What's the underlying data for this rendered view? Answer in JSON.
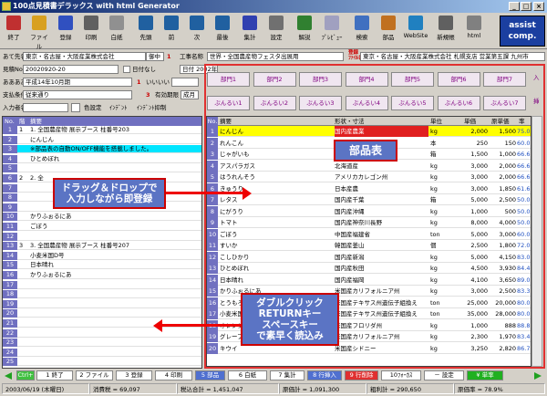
{
  "window": {
    "title": "100点見積書デラックス with html Generator",
    "btn_min": "_",
    "btn_max": "□",
    "btn_close": "×"
  },
  "toolbar": [
    {
      "id": "exit",
      "label": "終了",
      "icon": "door-icon",
      "color": "#c03030"
    },
    {
      "id": "file",
      "label": "ファイル",
      "icon": "folder-icon",
      "color": "#d8a020"
    },
    {
      "id": "register",
      "label": "登録",
      "icon": "disk-icon",
      "color": "#3050c0"
    },
    {
      "id": "print",
      "label": "印刷",
      "icon": "printer-icon",
      "color": "#606060"
    },
    {
      "id": "blank",
      "label": "白紙",
      "icon": "blank-page-icon",
      "color": "#909090"
    },
    {
      "id": "first",
      "label": "先頭",
      "icon": "first-icon",
      "color": "#2060a0"
    },
    {
      "id": "prev",
      "label": "前",
      "icon": "prev-icon",
      "color": "#2060a0"
    },
    {
      "id": "next",
      "label": "次",
      "icon": "next-icon",
      "color": "#2060a0"
    },
    {
      "id": "last",
      "label": "最後",
      "icon": "last-icon",
      "color": "#2060a0"
    },
    {
      "id": "total",
      "label": "集計",
      "icon": "sigma-icon",
      "color": "#3040b0"
    },
    {
      "id": "settings",
      "label": "設定",
      "icon": "gear-icon",
      "color": "#707070"
    },
    {
      "id": "help",
      "label": "解説",
      "icon": "book-icon",
      "color": "#308030"
    },
    {
      "id": "preview",
      "label": "ﾌﾟﾚﾋﾞｭｰ",
      "icon": "preview-icon",
      "color": "#a0a0c0"
    },
    {
      "id": "search",
      "label": "検索",
      "icon": "search-icon",
      "color": "#4070c0"
    },
    {
      "id": "parts",
      "label": "部品",
      "icon": "parts-icon",
      "color": "#c07020"
    },
    {
      "id": "website",
      "label": "WebSite",
      "icon": "globe-icon",
      "color": "#2080c0"
    },
    {
      "id": "newdoc",
      "label": "新規帳",
      "icon": "newdoc-icon",
      "color": "#606060"
    },
    {
      "id": "html",
      "label": "html",
      "icon": "html-icon",
      "color": "#808080"
    }
  ],
  "logo": {
    "line1": "assist",
    "line2": "comp."
  },
  "form": {
    "atesaki_label": "あて先名",
    "atesaki_value": "東京・名古屋・大阪産業株式会社",
    "atesaki_unit": "御中",
    "atesaki_flag": "1",
    "koji_label": "工事名称",
    "koji_value": "世界・全国農産物フェスタ出展用",
    "toroku_label": "登録\nﾌｧｲﾙ名",
    "toroku_value": "東京・名古屋・大阪産業株式会社 札幌支店 営業第五課 九州市",
    "mitsumori_label": "見積No.",
    "mitsumori_value": "20020920-20",
    "nichiji_label": "日付なし",
    "date_value": "日付 2002年",
    "doc_label": "ああああ",
    "doc_value": "平成14年10月期",
    "kigen_label": "いいいい",
    "kigen_flag": "1",
    "shiharai_label": "支払条件",
    "shiharai_value": "従来通り",
    "shiharai_flag": "3",
    "yukokigen_label": "有効期限",
    "yukokigen_value": "成月",
    "nyuryoku_label": "入力者名",
    "iro_label": "色設定",
    "indent_label": "ｲﾝﾃﾞﾝﾄ",
    "indent_label2": "ｲﾝﾃﾞﾝﾄ抑制"
  },
  "tabs_row1": [
    "部門1",
    "部門2",
    "部門3",
    "部門4",
    "部門5",
    "部門6",
    "部門7"
  ],
  "tabs_row2": [
    "ぶんるい1",
    "ぶんるい2",
    "ぶんるい3",
    "ぶんるい4",
    "ぶんるい5",
    "ぶんるい6",
    "ぶんるい7"
  ],
  "tab_side1": "入",
  "tab_side2": "挿",
  "left_grid": {
    "headers": [
      "No.",
      "階",
      "摘要"
    ],
    "rows": [
      {
        "no": "1",
        "lv": "1",
        "text": "1. 全国農産物 展示ブース 柱番号203",
        "hl": false
      },
      {
        "no": "2",
        "lv": "",
        "text": "にんじん",
        "hl": false
      },
      {
        "no": "3",
        "lv": "",
        "text": "※部品表の自動ON/OFF機能を搭載しました。",
        "hl": true
      },
      {
        "no": "4",
        "lv": "",
        "text": "ひとめぼれ",
        "hl": false
      },
      {
        "no": "5",
        "lv": "",
        "text": "",
        "hl": false
      },
      {
        "no": "6",
        "lv": "2",
        "text": "2. 全",
        "hl": false
      },
      {
        "no": "7",
        "lv": "",
        "text": "",
        "hl": false
      },
      {
        "no": "8",
        "lv": "",
        "text": "",
        "hl": false
      },
      {
        "no": "9",
        "lv": "",
        "text": "",
        "hl": false
      },
      {
        "no": "10",
        "lv": "",
        "text": "かりふぉるにあ",
        "hl": false
      },
      {
        "no": "11",
        "lv": "",
        "text": "ごぼう",
        "hl": false
      },
      {
        "no": "12",
        "lv": "",
        "text": "",
        "hl": false
      },
      {
        "no": "13",
        "lv": "3",
        "text": "3. 全国農産物 展示ブース 柱番号207",
        "hl": false
      },
      {
        "no": "14",
        "lv": "",
        "text": "小麦米国D号",
        "hl": false
      },
      {
        "no": "15",
        "lv": "",
        "text": "日本晴れ",
        "hl": false
      },
      {
        "no": "16",
        "lv": "",
        "text": "かりふぉるにあ",
        "hl": false
      },
      {
        "no": "17",
        "lv": "",
        "text": "",
        "hl": false
      },
      {
        "no": "18",
        "lv": "",
        "text": "",
        "hl": false
      },
      {
        "no": "19",
        "lv": "",
        "text": "",
        "hl": false
      },
      {
        "no": "20",
        "lv": "",
        "text": "",
        "hl": false
      },
      {
        "no": "21",
        "lv": "",
        "text": "",
        "hl": false
      },
      {
        "no": "22",
        "lv": "",
        "text": "",
        "hl": false
      },
      {
        "no": "23",
        "lv": "",
        "text": "",
        "hl": false
      },
      {
        "no": "24",
        "lv": "",
        "text": "",
        "hl": false
      },
      {
        "no": "25",
        "lv": "",
        "text": "",
        "hl": false
      }
    ]
  },
  "parts_grid": {
    "headers": [
      "No.",
      "摘要",
      "形状・寸法",
      "単位",
      "単価",
      "原単価",
      "率"
    ],
    "rows": [
      {
        "no": "1",
        "name": "にんじん",
        "spec": "国内産農業",
        "unit": "kg",
        "price": "2,000",
        "cost": "1,500",
        "rate": "75.0K",
        "sel": true
      },
      {
        "no": "2",
        "name": "れんこん",
        "spec": "中国",
        "unit": "本",
        "price": "250",
        "cost": "150",
        "rate": "60.0K"
      },
      {
        "no": "3",
        "name": "じゃがいも",
        "spec": "北海",
        "unit": "箱",
        "price": "1,500",
        "cost": "1,000",
        "rate": "66.6K"
      },
      {
        "no": "4",
        "name": "アスパラガス",
        "spec": "北海道産",
        "unit": "kg",
        "price": "3,000",
        "cost": "2,000",
        "rate": "66.6K"
      },
      {
        "no": "5",
        "name": "はうれんそう",
        "spec": "アメリカカレゴン州",
        "unit": "kg",
        "price": "3,000",
        "cost": "2,000",
        "rate": "66.6K"
      },
      {
        "no": "6",
        "name": "きゅうり",
        "spec": "日本産農",
        "unit": "kg",
        "price": "3,000",
        "cost": "1,850",
        "rate": "61.6K"
      },
      {
        "no": "7",
        "name": "レタス",
        "spec": "国内産千葉",
        "unit": "箱",
        "price": "5,000",
        "cost": "2,500",
        "rate": "50.0K"
      },
      {
        "no": "8",
        "name": "にがうり",
        "spec": "国内産沖縄",
        "unit": "kg",
        "price": "1,000",
        "cost": "500",
        "rate": "50.0K"
      },
      {
        "no": "9",
        "name": "トマト",
        "spec": "国内産神奈川長野",
        "unit": "kg",
        "price": "8,000",
        "cost": "4,000",
        "rate": "50.0K"
      },
      {
        "no": "10",
        "name": "ごぼう",
        "spec": "中国産福建省",
        "unit": "ton",
        "price": "5,000",
        "cost": "3,000",
        "rate": "60.0K"
      },
      {
        "no": "11",
        "name": "すいか",
        "spec": "韓国産釜山",
        "unit": "個",
        "price": "2,500",
        "cost": "1,800",
        "rate": "72.0K"
      },
      {
        "no": "12",
        "name": "こしひかり",
        "spec": "国内産新潟",
        "unit": "kg",
        "price": "5,000",
        "cost": "4,150",
        "rate": "83.0K"
      },
      {
        "no": "13",
        "name": "ひとめぼれ",
        "spec": "国内産秋田",
        "unit": "kg",
        "price": "4,500",
        "cost": "3,930",
        "rate": "84.4K"
      },
      {
        "no": "14",
        "name": "日本晴れ",
        "spec": "国内産福岡",
        "unit": "kg",
        "price": "4,100",
        "cost": "3,650",
        "rate": "89.0K"
      },
      {
        "no": "15",
        "name": "かりふぉるにあ",
        "spec": "米国産カリフォルニア州",
        "unit": "kg",
        "price": "3,000",
        "cost": "2,500",
        "rate": "83.3K"
      },
      {
        "no": "16",
        "name": "とうもろこし10号",
        "spec": "米国産テキサス州遺伝子組換え",
        "unit": "ton",
        "price": "25,000",
        "cost": "20,000",
        "rate": "80.0K"
      },
      {
        "no": "17",
        "name": "小麦米国D号",
        "spec": "米国産テキサス州遺伝子組換え",
        "unit": "ton",
        "price": "35,000",
        "cost": "28,000",
        "rate": "80.0K"
      },
      {
        "no": "18",
        "name": "オレンジ",
        "spec": "米国産フロリダ州",
        "unit": "kg",
        "price": "1,000",
        "cost": "888",
        "rate": "88.8K"
      },
      {
        "no": "19",
        "name": "グレープ",
        "spec": "米国産カリフォルニア州",
        "unit": "kg",
        "price": "2,300",
        "cost": "1,970",
        "rate": "83.4K"
      },
      {
        "no": "20",
        "name": "キウイ",
        "spec": "米国産シドニー",
        "unit": "kg",
        "price": "3,250",
        "cost": "2,820",
        "rate": "86.7K"
      }
    ]
  },
  "callouts": {
    "parts": "部品表",
    "drag_line1": "ドラッグ＆ドロップで",
    "drag_line2": "入力しながら即登録",
    "dbl_line1": "ダブルクリック",
    "dbl_line2": "RETURNキー",
    "dbl_line3": "スペースキー",
    "dbl_line4": "で素早く読込み"
  },
  "fkeys": [
    {
      "label": "Ctrl+",
      "bg": "#40c040",
      "fg": "#fff"
    },
    {
      "label": "1 終了",
      "bg": "#fff",
      "fg": "#000"
    },
    {
      "label": "2 ファイル",
      "bg": "#fff",
      "fg": "#000"
    },
    {
      "label": "3 登録",
      "bg": "#fff",
      "fg": "#000"
    },
    {
      "label": "4 印刷",
      "bg": "#fff",
      "fg": "#000"
    },
    {
      "label": "5 部品",
      "bg": "#5070d0",
      "fg": "#fff"
    },
    {
      "label": "6 白紙",
      "bg": "#fff",
      "fg": "#000"
    },
    {
      "label": "7 集計",
      "bg": "#fff",
      "fg": "#000"
    },
    {
      "label": "8 行挿入",
      "bg": "#5070d0",
      "fg": "#fff"
    },
    {
      "label": "9 行削除",
      "bg": "#e03030",
      "fg": "#fff"
    },
    {
      "label": "10ﾌｫｰｶｽ",
      "bg": "#fff",
      "fg": "#000"
    },
    {
      "label": "－ 設定",
      "bg": "#fff",
      "fg": "#000"
    },
    {
      "label": "¥ 単率",
      "bg": "#20b020",
      "fg": "#fff"
    }
  ],
  "status": {
    "date": "2003/06/19 (木曜日)",
    "tax": "消費税 = 69,097",
    "total": "税込合計 = 1,451,047",
    "cost": "原価計 = 1,091,300",
    "profit": "粗利計 = 290,650",
    "ratio": "原価率 = 78.9%"
  }
}
